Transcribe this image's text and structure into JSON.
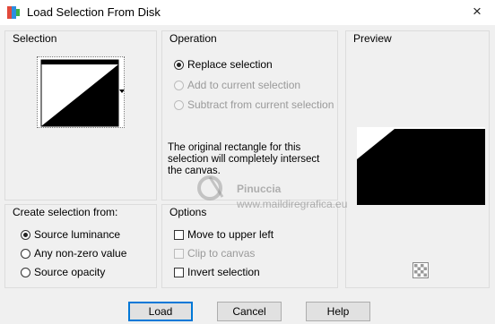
{
  "window": {
    "title": "Load Selection From Disk",
    "close_glyph": "×"
  },
  "selection_panel": {
    "title": "Selection"
  },
  "operation_panel": {
    "title": "Operation",
    "options": [
      {
        "label": "Replace selection",
        "checked": true,
        "enabled": true
      },
      {
        "label": "Add to current selection",
        "checked": false,
        "enabled": false
      },
      {
        "label": "Subtract from current selection",
        "checked": false,
        "enabled": false
      }
    ],
    "info_lines": [
      "The original rectangle for this",
      "selection will completely intersect",
      "the canvas."
    ]
  },
  "preview_panel": {
    "title": "Preview"
  },
  "create_panel": {
    "title": "Create selection from:",
    "options": [
      {
        "label": "Source luminance",
        "checked": true
      },
      {
        "label": "Any non-zero value",
        "checked": false
      },
      {
        "label": "Source opacity",
        "checked": false
      }
    ]
  },
  "options_panel": {
    "title": "Options",
    "items": [
      {
        "label": "Move to upper left",
        "checked": false,
        "enabled": true
      },
      {
        "label": "Clip to canvas",
        "checked": false,
        "enabled": false
      },
      {
        "label": "Invert selection",
        "checked": false,
        "enabled": true
      }
    ]
  },
  "buttons": {
    "load": "Load",
    "cancel": "Cancel",
    "help": "Help"
  },
  "watermark": {
    "line1": "Pinuccia",
    "line2": "www.maildiregrafica.eu"
  },
  "colors": {
    "accent": "#0078d7",
    "panel_border": "#dcdcdc",
    "background": "#f0f0f0"
  }
}
